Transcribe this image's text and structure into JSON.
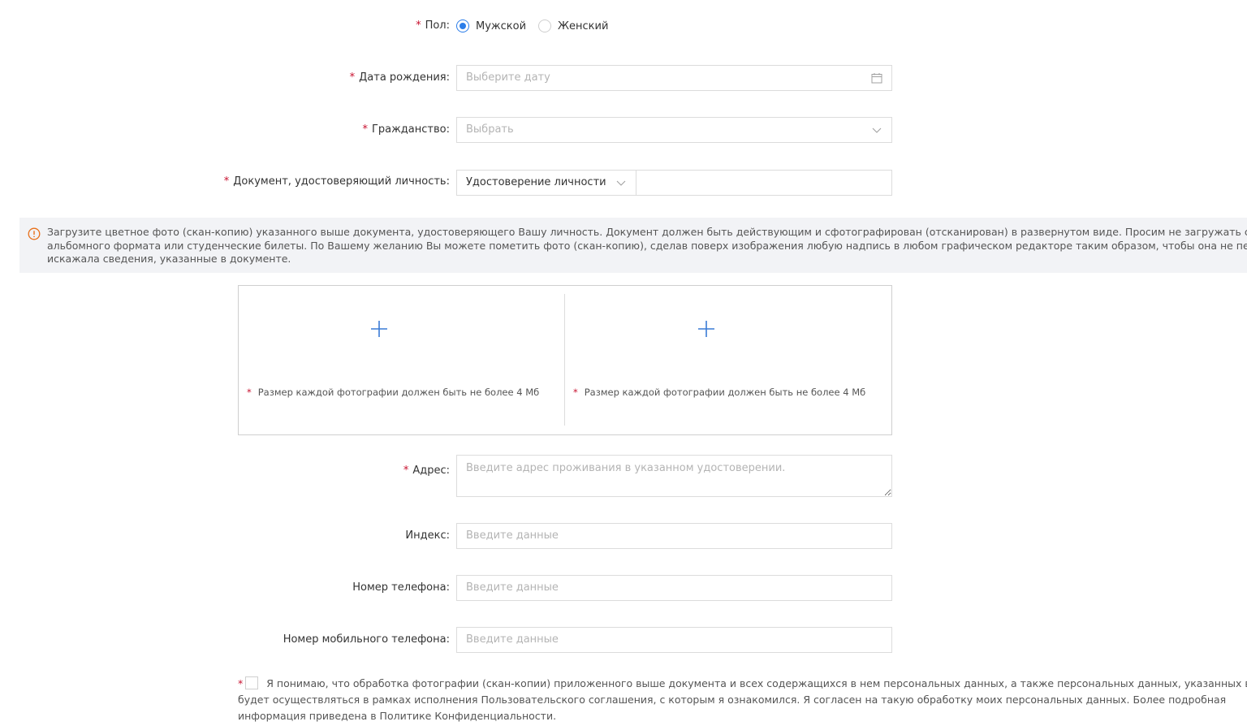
{
  "gender": {
    "label": "Пол",
    "options": [
      {
        "label": "Мужской",
        "selected": true
      },
      {
        "label": "Женский",
        "selected": false
      }
    ]
  },
  "birth_date": {
    "label": "Дата рождения",
    "placeholder": "Выберите дату"
  },
  "citizenship": {
    "label": "Гражданство",
    "placeholder": "Выбрать"
  },
  "document": {
    "label": "Документ, удостоверяющий личность",
    "type_value": "Удостоверение личности",
    "number_value": ""
  },
  "notice": {
    "text": "Загрузите цветное фото (скан-копию) указанного выше документа, удостоверяющего Вашу личность. Документ должен быть действующим и сфотографирован (отсканирован) в развернутом виде. Просим не загружать селфи, изображения альбомного формата или студенческие билеты. По Вашему желанию Вы можете пометить фото (скан-копию), сделав поверх изображения любую надпись в любом графическом редакторе таким образом, чтобы она не перекрывала и не искажала сведения, указанные в документе."
  },
  "upload": {
    "slots": [
      {
        "hint": "Размер каждой фотографии должен быть не более 4 Мб"
      },
      {
        "hint": "Размер каждой фотографии должен быть не более 4 Мб"
      }
    ]
  },
  "address": {
    "label": "Адрес",
    "placeholder": "Введите адрес проживания в указанном удостоверении."
  },
  "postal_code": {
    "label": "Индекс",
    "placeholder": "Введите данные"
  },
  "phone": {
    "label": "Номер телефона",
    "placeholder": "Введите данные"
  },
  "mobile": {
    "label": "Номер мобильного телефона",
    "placeholder": "Введите данные"
  },
  "agreement": {
    "text": "Я понимаю, что обработка фотографии (скан-копии) приложенного выше документа и всех содержащихся в нем персональных данных, а также персональных данных, указанных выше, будет осуществляться в рамках исполнения Пользовательского соглашения, с которым я ознакомился. Я согласен на такую обработку моих персональных данных. Более подробная информация приведена в Политике Конфиденциальности."
  },
  "colors": {
    "accent": "#2b7de9",
    "required": "#c8102e",
    "warning": "#e8701a"
  }
}
